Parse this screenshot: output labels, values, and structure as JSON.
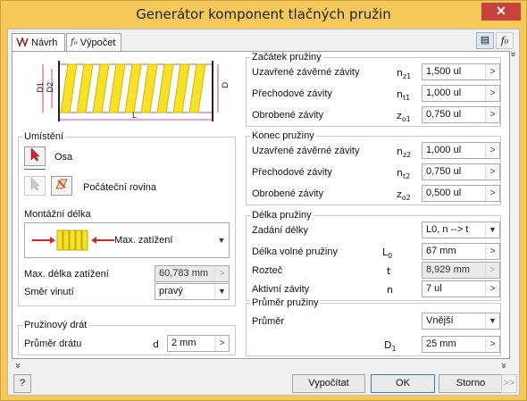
{
  "window": {
    "title": "Generátor komponent tlačných pružin",
    "close_glyph": "✕"
  },
  "tabs": [
    {
      "label": "Návrh",
      "icon": "spring-icon"
    },
    {
      "label": "Výpočet",
      "icon": "formula-icon"
    }
  ],
  "diagram": {
    "labels": {
      "d1": "D1",
      "d2": "D2",
      "d": "D",
      "l": "L"
    },
    "colors": {
      "coil": "#f5e12a",
      "dim": "#e0007a"
    }
  },
  "placement": {
    "title": "Umístění",
    "axis_label": "Osa",
    "plane_label": "Počáteční rovina",
    "montage_label": "Montážní délka",
    "montage_option": "Max. zatížení",
    "max_length_label": "Max. délka zatížení",
    "max_length_value": "60,783 mm",
    "winding_label": "Směr vinutí",
    "winding_value": "pravý"
  },
  "wire": {
    "title": "Pružinový drát",
    "diameter_label": "Průměr drátu",
    "diameter_sym": "d",
    "diameter_value": "2 mm"
  },
  "start": {
    "title": "Začátek pružiny",
    "rows": [
      {
        "label": "Uzavřené závěrné závity",
        "sym": "n",
        "sub": "z1",
        "value": "1,500 ul"
      },
      {
        "label": "Přechodové závity",
        "sym": "n",
        "sub": "t1",
        "value": "1,000 ul"
      },
      {
        "label": "Obrobené závity",
        "sym": "z",
        "sub": "o1",
        "value": "0,750 ul"
      }
    ]
  },
  "end": {
    "title": "Konec pružiny",
    "rows": [
      {
        "label": "Uzavřené závěrné závity",
        "sym": "n",
        "sub": "z2",
        "value": "1,000 ul"
      },
      {
        "label": "Přechodové závity",
        "sym": "n",
        "sub": "t2",
        "value": "0,750 ul"
      },
      {
        "label": "Obrobené závity",
        "sym": "z",
        "sub": "o2",
        "value": "0,500 ul"
      }
    ]
  },
  "length": {
    "title": "Délka pružiny",
    "entry_label": "Zadání délky",
    "entry_value": "L0, n --> t",
    "free_label": "Délka volné pružiny",
    "free_sym": "L",
    "free_sub": "0",
    "free_value": "67 mm",
    "pitch_label": "Rozteč",
    "pitch_sym": "t",
    "pitch_value": "8,929 mm",
    "active_label": "Aktivní závity",
    "active_sym": "n",
    "active_value": "7 ul"
  },
  "diameter": {
    "title": "Průměr pružiny",
    "label": "Průměr",
    "select_value": "Vnější",
    "sym": "D",
    "sub": "1",
    "value": "25 mm"
  },
  "footer": {
    "calc": "Vypočítat",
    "ok": "OK",
    "cancel": "Storno",
    "help": "?",
    "more": ">>"
  },
  "glyphs": {
    "arrow": ">",
    "dropdown": "▼",
    "chev_up": "»",
    "chev_down": "»"
  }
}
